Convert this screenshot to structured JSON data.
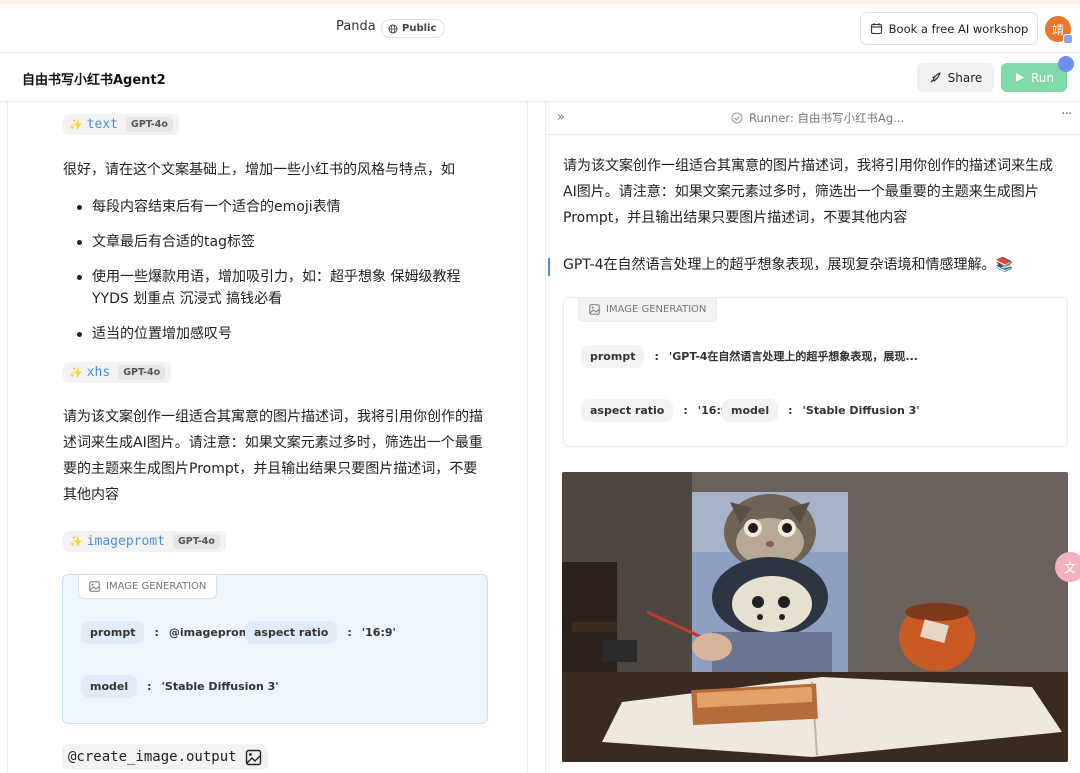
{
  "header": {
    "brand": "Panda",
    "visibility": "Public",
    "workshop_button": "Book a free AI workshop",
    "avatar_initial": "靖"
  },
  "subheader": {
    "agent_title": "自由书写小红书Agent2",
    "share_label": "Share",
    "run_label": "Run"
  },
  "left": {
    "steps": [
      {
        "name": "text",
        "model": "GPT-4o"
      },
      {
        "name": "xhs",
        "model": "GPT-4o"
      },
      {
        "name": "imagepromt",
        "model": "GPT-4o"
      }
    ],
    "text_intro": "很好，请在这个文案基础上，增加一些小红书的风格与特点，如",
    "bullets": [
      "每段内容结束后有一个适合的emoji表情",
      "文章最后有合适的tag标签",
      "使用一些爆款用语，增加吸引力，如：超乎想象 保姆级教程 YYDS 划重点 沉浸式 搞钱必看",
      "适当的位置增加感叹号"
    ],
    "xhs_prompt": "请为该文案创作一组适合其寓意的图片描述词，我将引用你创作的描述词来生成AI图片。请注意：如果文案元素过多时，筛选出一个最重要的主题来生成图片Prompt，并且输出结果只要图片描述词，不要其他内容",
    "image_generation": {
      "label": "IMAGE GENERATION",
      "prompt_key": "prompt",
      "prompt_value": "@imagepromt",
      "aspect_key": "aspect ratio",
      "aspect_value": "'16:9'",
      "model_key": "model",
      "model_value": "'Stable Diffusion 3'"
    },
    "output_ref": "@create_image.output"
  },
  "right": {
    "runner_label": "Runner: 自由书写小红书Ag...",
    "prompt_text": "请为该文案创作一组适合其寓意的图片描述词，我将引用你创作的描述词来生成AI图片。请注意：如果文案元素过多时，筛选出一个最重要的主题来生成图片Prompt，并且输出结果只要图片描述词，不要其他内容",
    "response_text": "GPT-4在自然语言处理上的超乎想象表现，展现复杂语境和情感理解。📚",
    "image_generation": {
      "label": "IMAGE GENERATION",
      "prompt_key": "prompt",
      "prompt_value": "'GPT-4在自然语言处理上的超乎想象表现，展现...",
      "aspect_key": "aspect ratio",
      "aspect_value": "'16:9'",
      "model_key": "model",
      "model_value": "'Stable Diffusion 3'"
    }
  },
  "floating": {
    "translate_icon": "文"
  },
  "colors": {
    "accent_blue": "#4a8fd8",
    "run_green": "#7fd9a8",
    "avatar_orange": "#e8772e"
  }
}
